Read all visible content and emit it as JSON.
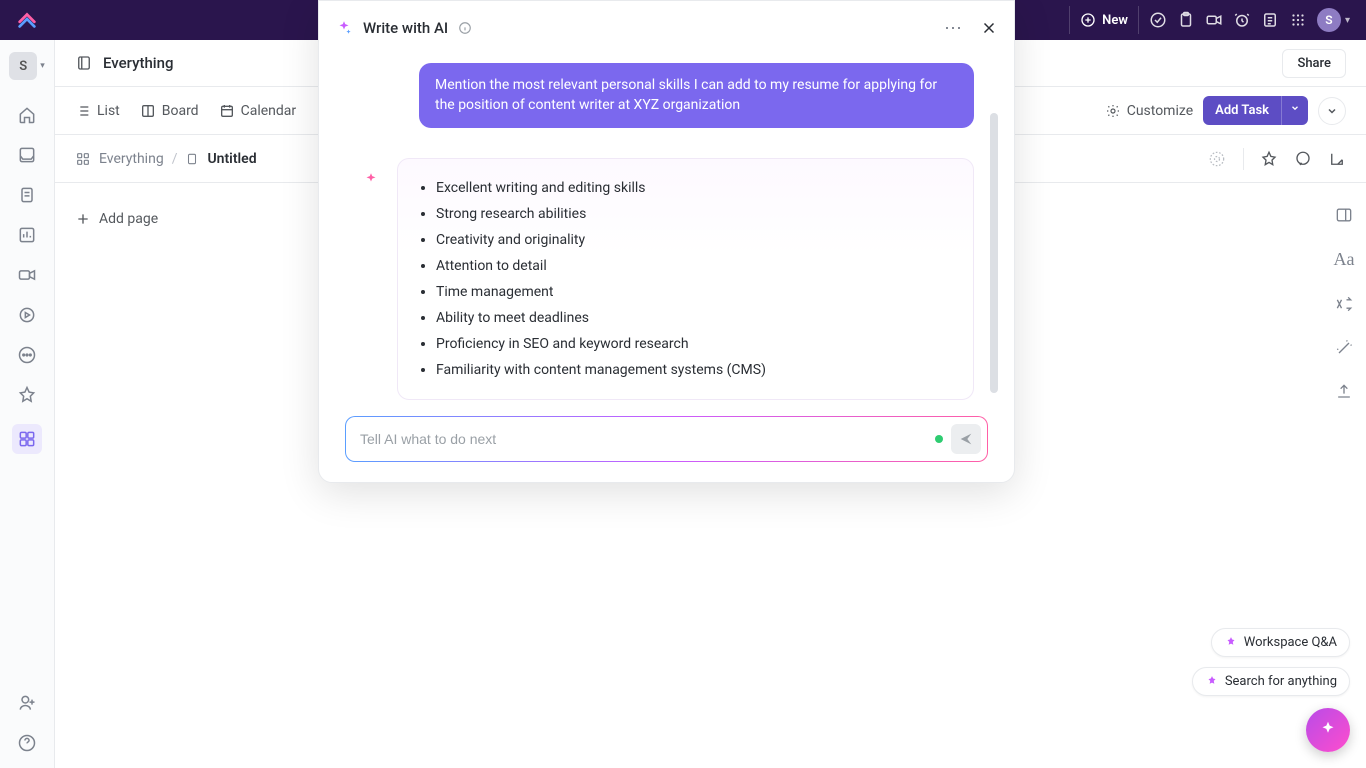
{
  "topbar": {
    "new_label": "New",
    "avatar_initial": "S"
  },
  "sidebar": {
    "workspace_initial": "S"
  },
  "header": {
    "title": "Everything",
    "share_label": "Share"
  },
  "tabs": {
    "list": "List",
    "board": "Board",
    "calendar": "Calendar",
    "customize": "Customize",
    "add_task": "Add Task"
  },
  "breadcrumb": {
    "root": "Everything",
    "current": "Untitled"
  },
  "page": {
    "add_page": "Add page"
  },
  "chips": {
    "qa": "Workspace Q&A",
    "search": "Search for anything"
  },
  "ai": {
    "title": "Write with AI",
    "user_prompt": "Mention the most relevant personal skills I can add to my resume for applying for the position of content writer at XYZ organization",
    "response_items": [
      "Excellent writing and editing skills",
      "Strong research abilities",
      "Creativity and originality",
      "Attention to detail",
      "Time management",
      "Ability to meet deadlines",
      "Proficiency in SEO and keyword research",
      "Familiarity with content management systems (CMS)"
    ],
    "input_placeholder": "Tell AI what to do next"
  }
}
